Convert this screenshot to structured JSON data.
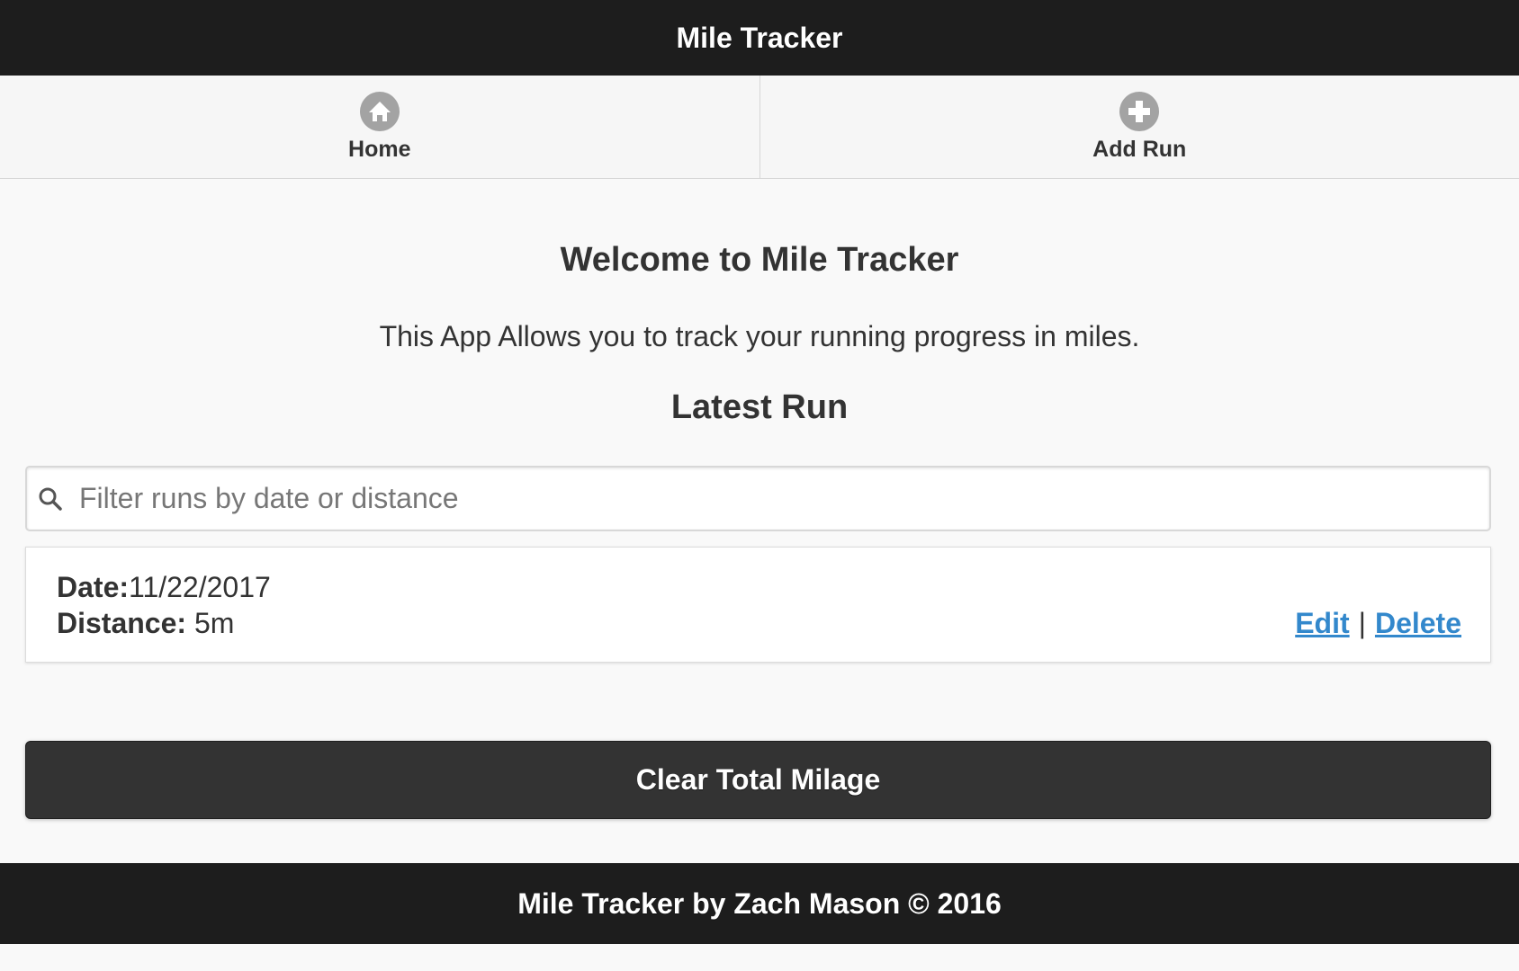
{
  "header": {
    "title": "Mile Tracker"
  },
  "nav": {
    "items": [
      {
        "label": "Home",
        "icon": "home-icon"
      },
      {
        "label": "Add Run",
        "icon": "plus-icon"
      }
    ]
  },
  "main": {
    "welcome": "Welcome to Mile Tracker",
    "tagline": "This App Allows you to track your running progress in miles.",
    "latest_heading": "Latest Run",
    "search": {
      "placeholder": "Filter runs by date or distance",
      "value": "",
      "icon": "search-icon"
    },
    "run": {
      "date_label": "Date:",
      "date_value": "11/22/2017",
      "distance_label": "Distance:",
      "distance_value": " 5m",
      "edit_label": "Edit",
      "separator": "|",
      "delete_label": "Delete"
    },
    "clear_button_label": "Clear Total Milage"
  },
  "footer": {
    "text": "Mile Tracker by Zach Mason © 2016"
  },
  "colors": {
    "header_bg": "#1d1d1d",
    "link": "#3388cc",
    "button_bg": "#333333",
    "icon_gray": "#a3a3a3"
  }
}
